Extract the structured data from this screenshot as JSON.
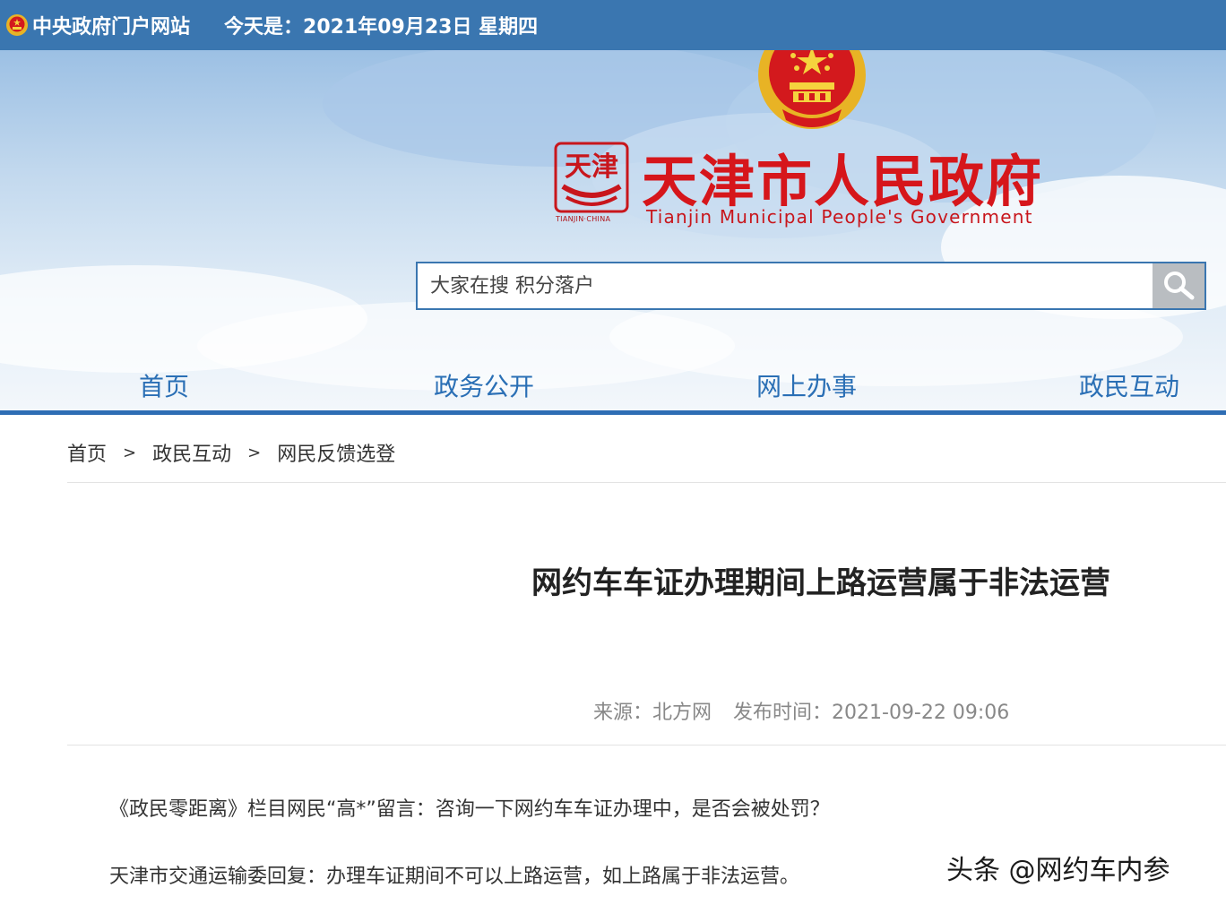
{
  "topbar": {
    "portal_label": "中央政府门户网站",
    "date_text": "今天是：2021年09月23日 星期四"
  },
  "header": {
    "site_title": "天津市人民政府",
    "site_subtitle": "Tianjin Municipal People's Government",
    "seal_text": "天津",
    "seal_caption": "TIANJIN·CHINA"
  },
  "search": {
    "placeholder": "大家在搜 积分落户"
  },
  "nav": {
    "items": [
      "首页",
      "政务公开",
      "网上办事",
      "政民互动"
    ]
  },
  "breadcrumb": {
    "items": [
      "首页",
      "政民互动",
      "网民反馈选登"
    ],
    "separator": ">"
  },
  "article": {
    "title": "网约车车证办理期间上路运营属于非法运营",
    "source": "来源：北方网",
    "published": "发布时间：2021-09-22 09:06",
    "paragraphs": [
      "《政民零距离》栏目网民“高*”留言：咨询一下网约车车证办理中，是否会被处罚？",
      "天津市交通运输委回复：办理车证期间不可以上路运营，如上路属于非法运营。"
    ]
  },
  "watermark": "头条 @网约车内参",
  "colors": {
    "topbar_bg": "#3a76b0",
    "title_red": "#d6161b",
    "nav_blue": "#2a6fb5"
  }
}
